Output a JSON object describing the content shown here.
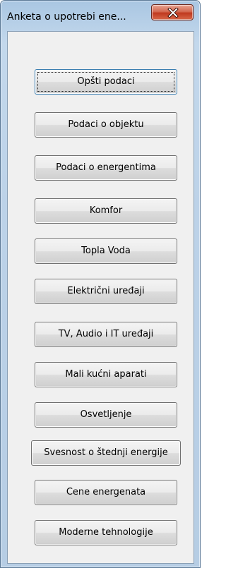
{
  "window": {
    "title": "Anketa o upotrebi ene..."
  },
  "menu": {
    "buttons": [
      {
        "label": "Opšti podaci"
      },
      {
        "label": "Podaci o objektu"
      },
      {
        "label": "Podaci o energentima"
      },
      {
        "label": "Komfor"
      },
      {
        "label": "Topla Voda"
      },
      {
        "label": "Električni uređaji"
      },
      {
        "label": "TV, Audio i IT uređaji"
      },
      {
        "label": "Mali kućni aparati"
      },
      {
        "label": "Osvetljenje"
      },
      {
        "label": "Svesnost o štednji energije"
      },
      {
        "label": "Cene energenata"
      },
      {
        "label": "Moderne tehnologije"
      }
    ]
  },
  "colors": {
    "frame": "#bcd2e8",
    "client_bg": "#f0f0f0",
    "close_button": "#c7432a"
  }
}
